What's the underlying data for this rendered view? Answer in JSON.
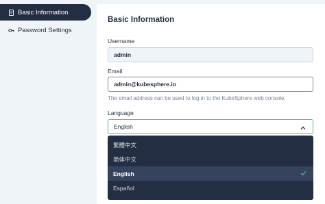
{
  "sidebar": {
    "items": [
      {
        "label": "Basic Information",
        "icon": "document-icon",
        "active": true
      },
      {
        "label": "Password Settings",
        "icon": "key-icon",
        "active": false
      }
    ]
  },
  "main": {
    "title": "Basic Information",
    "username": {
      "label": "Username",
      "value": "admin"
    },
    "email": {
      "label": "Email",
      "value": "admin@kubesphere.io",
      "hint": "The email address can be used to log in to the KubeSphere web console."
    },
    "language": {
      "label": "Language",
      "selected": "English",
      "options": [
        {
          "label": "繁體中文"
        },
        {
          "label": "简体中文"
        },
        {
          "label": "English"
        },
        {
          "label": "Español"
        }
      ]
    }
  },
  "colors": {
    "dark": "#242e42",
    "accent_green": "#55bc8a",
    "muted": "#79879c",
    "background": "#eff4f9"
  }
}
